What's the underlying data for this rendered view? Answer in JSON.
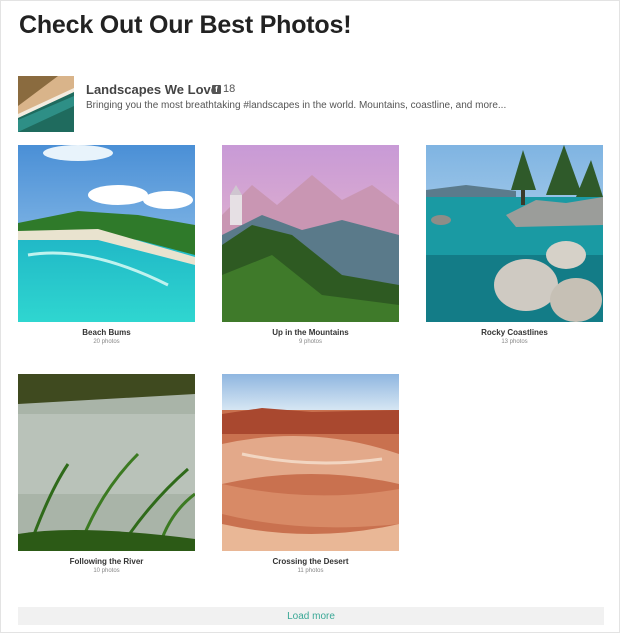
{
  "page": {
    "title": "Check Out Our Best Photos!"
  },
  "profile": {
    "name": "Landscapes We Love",
    "facebook_count": "18",
    "description": "Bringing you the most breathtaking #landscapes in the world. Mountains, coastline, and more...",
    "icon": "facebook-icon"
  },
  "albums": [
    {
      "name": "Beach Bums",
      "count": "20 photos"
    },
    {
      "name": "Up in the Mountains",
      "count": "9 photos"
    },
    {
      "name": "Rocky Coastlines",
      "count": "13 photos"
    },
    {
      "name": "Following the River",
      "count": "10 photos"
    },
    {
      "name": "Crossing the Desert",
      "count": "11 photos"
    }
  ],
  "load_more": {
    "label": "Load more"
  },
  "colors": {
    "accent": "#3aa896",
    "button_bg": "#f1f1f1"
  }
}
